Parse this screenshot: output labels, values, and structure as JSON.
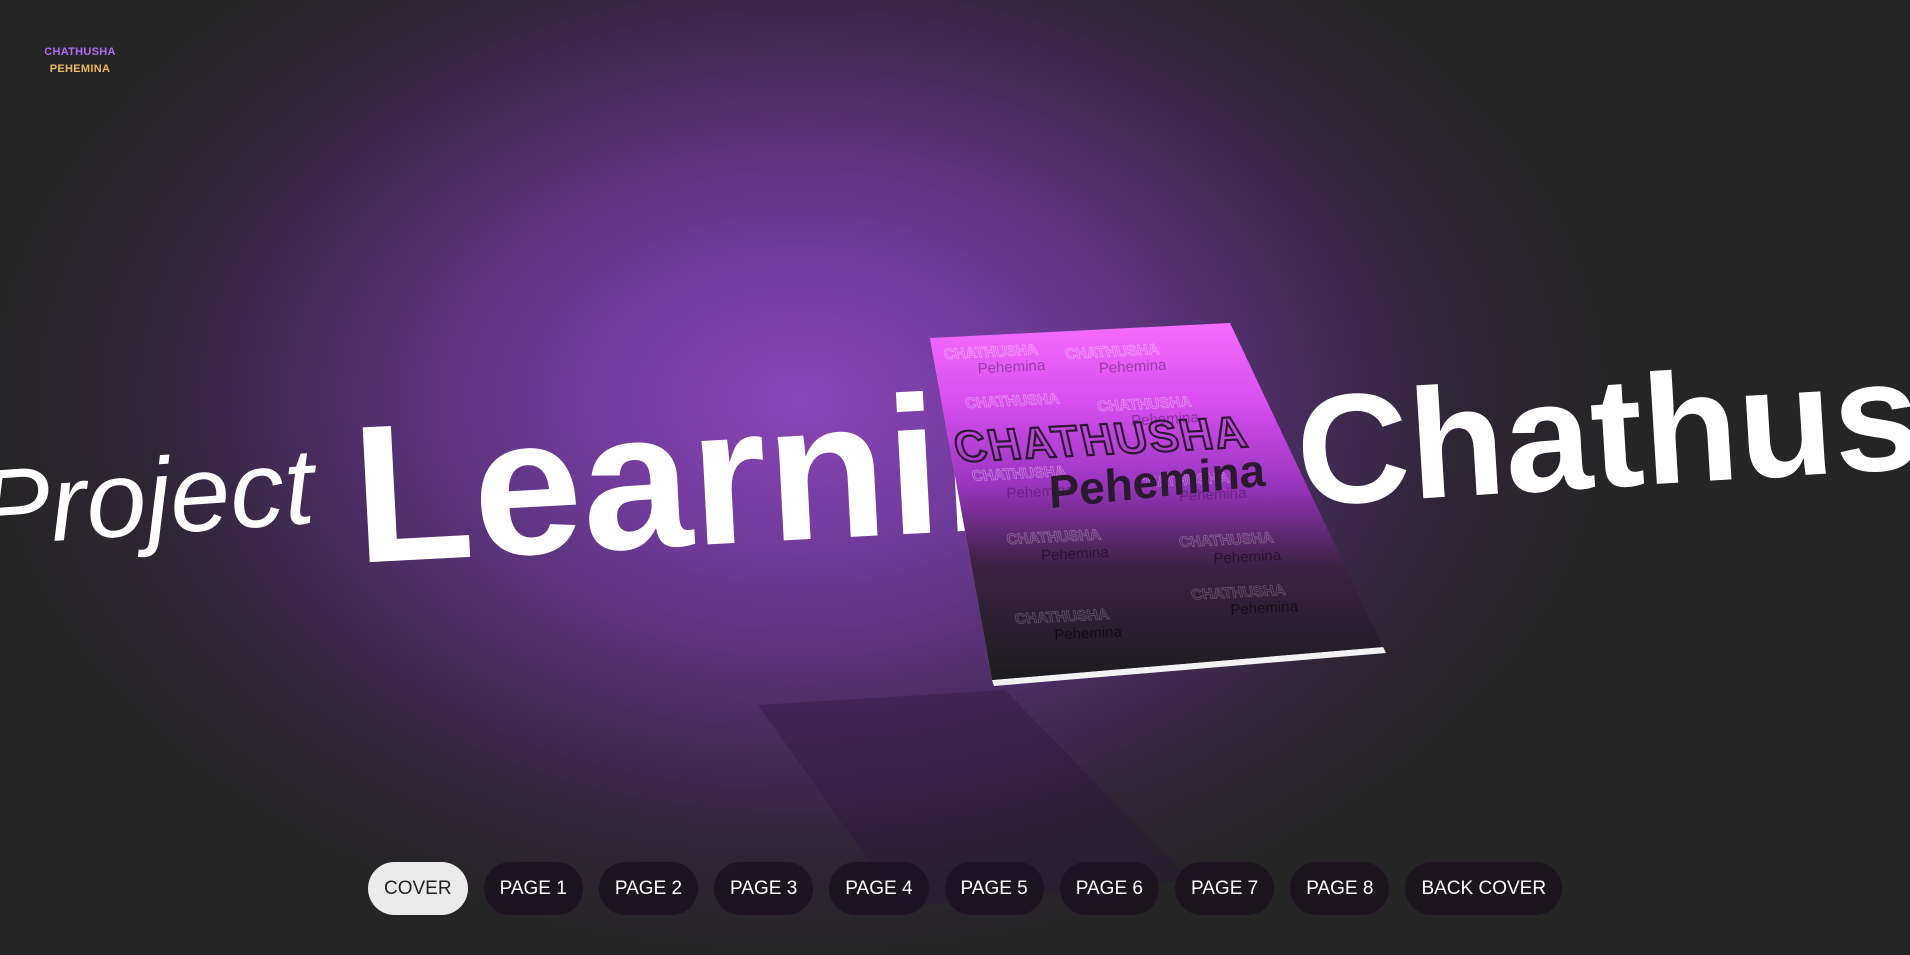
{
  "logo": {
    "line1": "CHATHUSHA",
    "line2": "PEHEMINA"
  },
  "scroll_text": {
    "project": "Project",
    "learning": "Learning",
    "name": "Chathusha"
  },
  "book_cover": {
    "title": "CHATHUSHA",
    "subtitle": "Pehemina",
    "pattern_title": "CHATHUSHA",
    "pattern_subtitle": "Pehemina",
    "gradient_top": "#f060ff",
    "gradient_bottom": "#1c1c1e"
  },
  "nav": {
    "buttons": [
      {
        "label": "COVER",
        "active": true
      },
      {
        "label": "PAGE 1",
        "active": false
      },
      {
        "label": "PAGE 2",
        "active": false
      },
      {
        "label": "PAGE 3",
        "active": false
      },
      {
        "label": "PAGE 4",
        "active": false
      },
      {
        "label": "PAGE 5",
        "active": false
      },
      {
        "label": "PAGE 6",
        "active": false
      },
      {
        "label": "PAGE 7",
        "active": false
      },
      {
        "label": "PAGE 8",
        "active": false
      },
      {
        "label": "BACK COVER",
        "active": false
      }
    ]
  },
  "colors": {
    "background": "#252525",
    "glow": "#8a45b8",
    "logo_line1": "#b06cf2",
    "logo_line2": "#f0b85a",
    "active_button": "#ebebeb"
  }
}
